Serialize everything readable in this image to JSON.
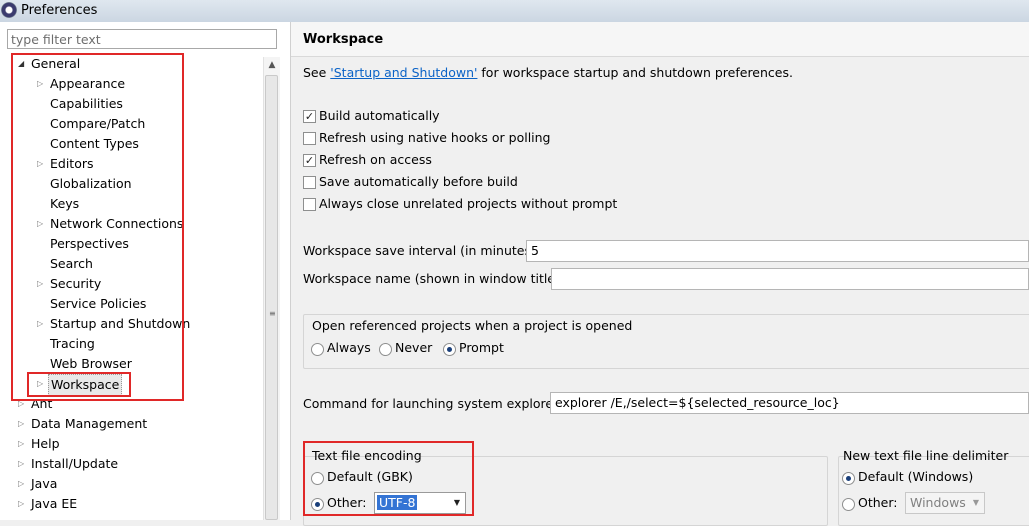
{
  "window": {
    "title": "Preferences"
  },
  "filter": {
    "placeholder": "type filter text"
  },
  "tree": {
    "general": "General",
    "general_children": [
      "Appearance",
      "Capabilities",
      "Compare/Patch",
      "Content Types",
      "Editors",
      "Globalization",
      "Keys",
      "Network Connections",
      "Perspectives",
      "Search",
      "Security",
      "Service Policies",
      "Startup and Shutdown",
      "Tracing",
      "Web Browser",
      "Workspace"
    ],
    "top_level": [
      "Ant",
      "Data Management",
      "Help",
      "Install/Update",
      "Java",
      "Java EE"
    ]
  },
  "page": {
    "title": "Workspace",
    "see_prefix": "See ",
    "see_link": "'Startup and Shutdown'",
    "see_suffix": " for workspace startup and shutdown preferences.",
    "checkboxes": [
      {
        "label": "Build automatically",
        "checked": true
      },
      {
        "label": "Refresh using native hooks or polling",
        "checked": false
      },
      {
        "label": "Refresh on access",
        "checked": true
      },
      {
        "label": "Save automatically before build",
        "checked": false
      },
      {
        "label": "Always close unrelated projects without prompt",
        "checked": false
      }
    ],
    "save_interval_label": "Workspace save interval (in minutes):",
    "save_interval_value": "5",
    "workspace_name_label": "Workspace name (shown in window title):",
    "workspace_name_value": "",
    "open_ref_group": "Open referenced projects when a project is opened",
    "open_ref_options": [
      "Always",
      "Never",
      "Prompt"
    ],
    "open_ref_selected": "Prompt",
    "explorer_label": "Command for launching system explorer:",
    "explorer_value": "explorer /E,/select=${selected_resource_loc}",
    "encoding_group": "Text file encoding",
    "encoding_default": "Default (GBK)",
    "encoding_other": "Other:",
    "encoding_value": "UTF-8",
    "delimiter_group": "New text file line delimiter",
    "delimiter_default": "Default (Windows)",
    "delimiter_other": "Other:",
    "delimiter_value": "Windows"
  }
}
